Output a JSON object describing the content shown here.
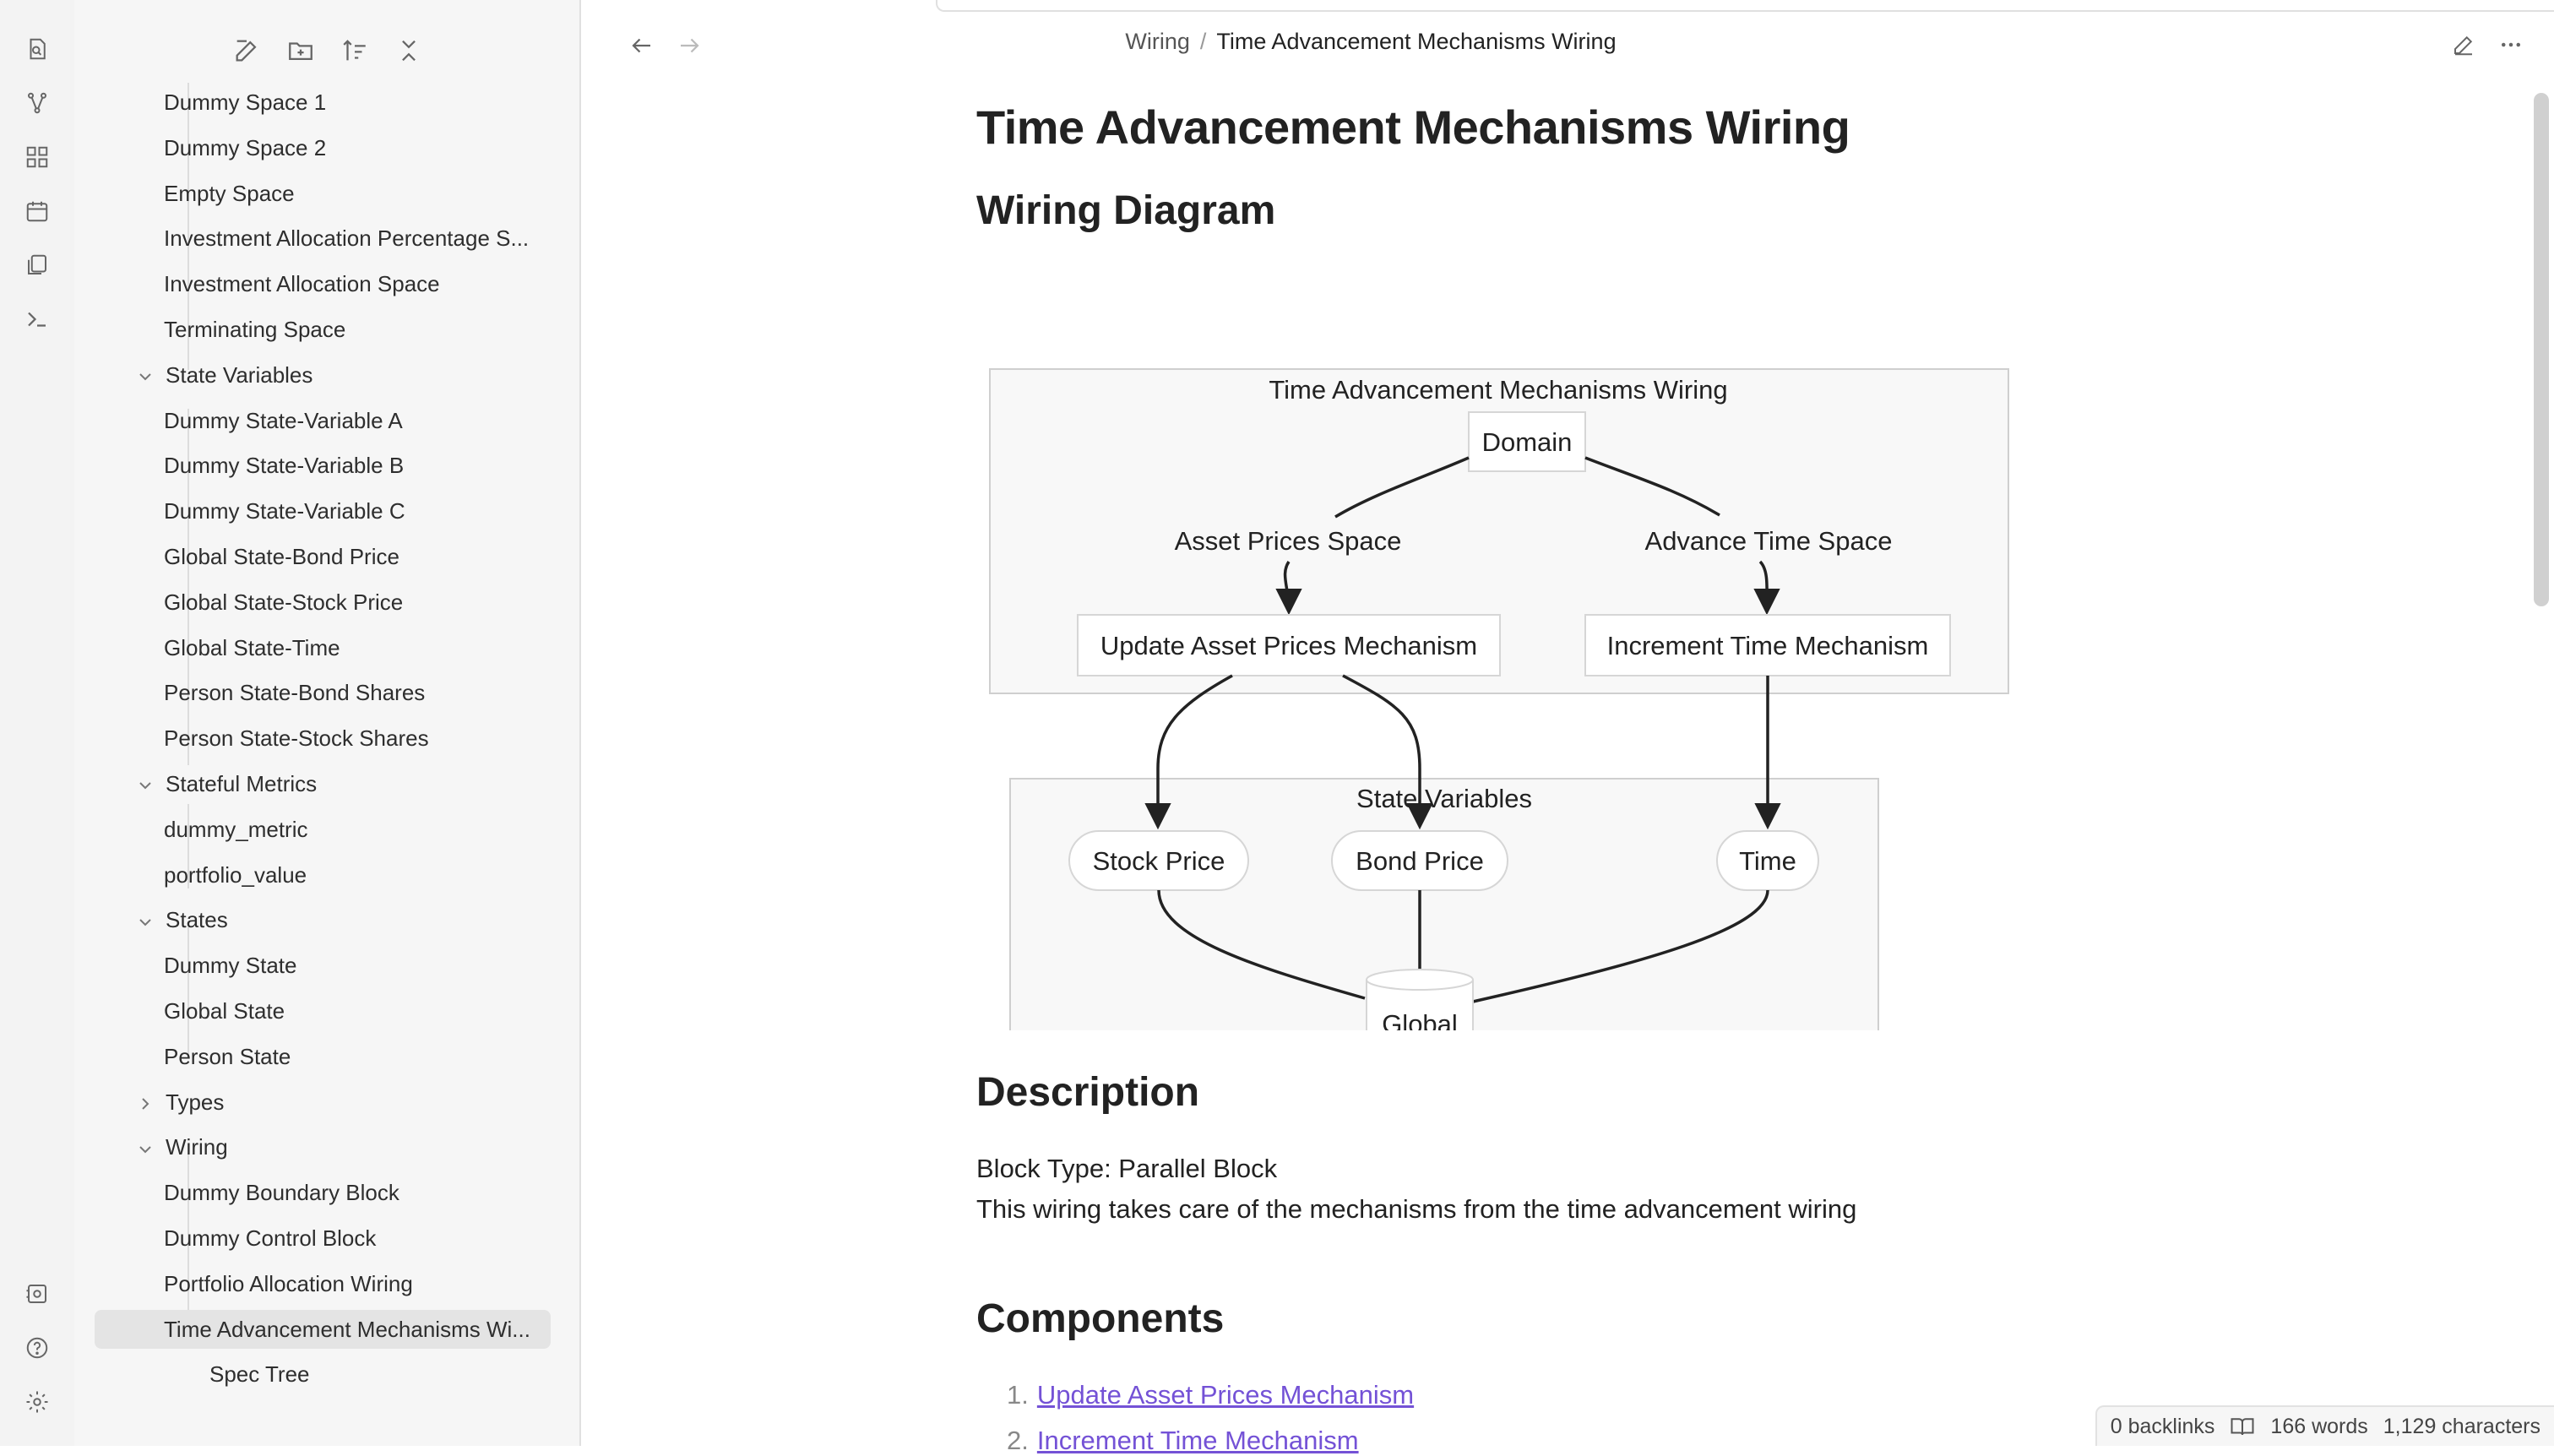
{
  "sidebar": {
    "tree": [
      {
        "kind": "child",
        "label": "Dummy Space 1"
      },
      {
        "kind": "child",
        "label": "Dummy Space 2"
      },
      {
        "kind": "child",
        "label": "Empty Space"
      },
      {
        "kind": "child",
        "label": "Investment Allocation Percentage S..."
      },
      {
        "kind": "child",
        "label": "Investment Allocation Space"
      },
      {
        "kind": "child",
        "label": "Terminating Space"
      },
      {
        "kind": "folder",
        "label": "State Variables",
        "expanded": true
      },
      {
        "kind": "child",
        "label": "Dummy State-Variable A"
      },
      {
        "kind": "child",
        "label": "Dummy State-Variable B"
      },
      {
        "kind": "child",
        "label": "Dummy State-Variable C"
      },
      {
        "kind": "child",
        "label": "Global State-Bond Price"
      },
      {
        "kind": "child",
        "label": "Global State-Stock Price"
      },
      {
        "kind": "child",
        "label": "Global State-Time"
      },
      {
        "kind": "child",
        "label": "Person State-Bond Shares"
      },
      {
        "kind": "child",
        "label": "Person State-Stock Shares"
      },
      {
        "kind": "folder",
        "label": "Stateful Metrics",
        "expanded": true
      },
      {
        "kind": "child",
        "label": "dummy_metric"
      },
      {
        "kind": "child",
        "label": "portfolio_value"
      },
      {
        "kind": "folder",
        "label": "States",
        "expanded": true
      },
      {
        "kind": "child",
        "label": "Dummy State"
      },
      {
        "kind": "child",
        "label": "Global State"
      },
      {
        "kind": "child",
        "label": "Person State"
      },
      {
        "kind": "folder",
        "label": "Types",
        "expanded": false
      },
      {
        "kind": "folder",
        "label": "Wiring",
        "expanded": true
      },
      {
        "kind": "child",
        "label": "Dummy Boundary Block"
      },
      {
        "kind": "child",
        "label": "Dummy Control Block"
      },
      {
        "kind": "child",
        "label": "Portfolio Allocation Wiring"
      },
      {
        "kind": "child",
        "label": "Time Advancement Mechanisms Wi...",
        "selected": true
      },
      {
        "kind": "file",
        "label": "Spec Tree"
      }
    ]
  },
  "topbar": {
    "breadcrumb_parent": "Wiring",
    "breadcrumb_sep": "/",
    "breadcrumb_current": "Time Advancement Mechanisms Wiring"
  },
  "note": {
    "title": "Time Advancement Mechanisms Wiring",
    "h_wiring": "Wiring Diagram",
    "h_description": "Description",
    "block_type": "Block Type: Parallel Block",
    "description": "This wiring takes care of the mechanisms from the time advancement wiring",
    "h_components": "Components",
    "components": [
      {
        "num": "1.",
        "label": "Update Asset Prices Mechanism"
      },
      {
        "num": "2.",
        "label": "Increment Time Mechanism"
      }
    ]
  },
  "diagram": {
    "outer_title": "Time Advancement Mechanisms Wiring",
    "domain": "Domain",
    "space_left": "Asset Prices Space",
    "space_right": "Advance Time Space",
    "mech_left": "Update Asset Prices Mechanism",
    "mech_right": "Increment Time Mechanism",
    "sv_title": "State Variables",
    "sv_stock": "Stock Price",
    "sv_bond": "Bond Price",
    "sv_time": "Time",
    "global": "Global"
  },
  "status": {
    "backlinks": "0 backlinks",
    "words": "166 words",
    "characters": "1,129 characters"
  },
  "colors": {
    "accent_link": "#7452d6",
    "sidebar_bg": "#f6f6f6",
    "selected_bg": "#e4e4e4"
  }
}
